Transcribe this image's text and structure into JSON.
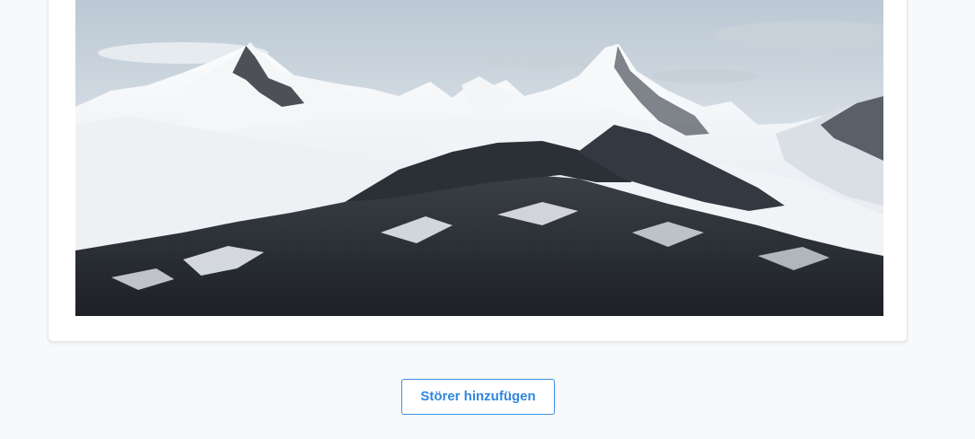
{
  "content_card": {
    "image_alt": "Snow-covered mountain range"
  },
  "actions": {
    "add_disruptor_label": "Störer hinzufügen"
  }
}
